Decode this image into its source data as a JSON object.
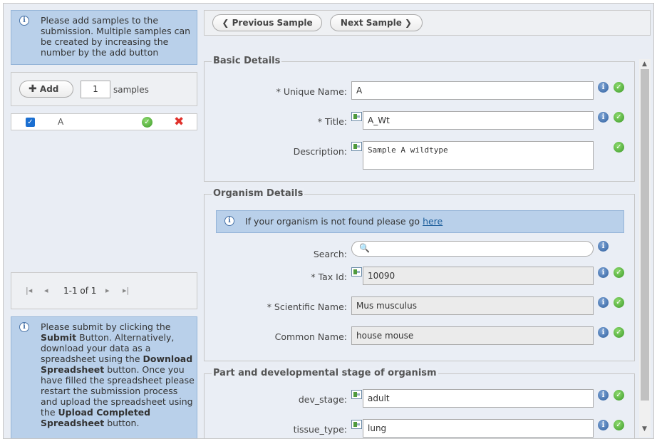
{
  "left": {
    "top_info": "Please add samples to the submission. Multiple samples can be created by increasing the number by the add button",
    "add_label": "Add",
    "count_value": "1",
    "samples_label": "samples",
    "list": [
      {
        "name": "A",
        "checked": true
      }
    ],
    "pager_text": "1-1 of 1",
    "bottom_info": [
      {
        "t": "Please submit by clicking the ",
        "b": false
      },
      {
        "t": "Submit",
        "b": true
      },
      {
        "t": " Button. Alternatively, download your data as a spreadsheet using the ",
        "b": false
      },
      {
        "t": "Download Spreadsheet",
        "b": true
      },
      {
        "t": " button. Once you have filled the spreadsheet please restart the submission process and upload the spreadsheet using the ",
        "b": false
      },
      {
        "t": "Upload Completed Spreadsheet",
        "b": true
      },
      {
        "t": " button.",
        "b": false
      }
    ]
  },
  "toolbar": {
    "prev_label": "Previous Sample",
    "next_label": "Next Sample"
  },
  "basic": {
    "legend": "Basic Details",
    "unique_label": "* Unique Name:",
    "unique_value": "A",
    "title_label": "* Title:",
    "title_value": "A_Wt",
    "desc_label": "Description:",
    "desc_value": "Sample A wildtype"
  },
  "organism": {
    "legend": "Organism Details",
    "notice_text": "If your organism is not found please go ",
    "notice_link": "here",
    "search_label": "Search:",
    "search_value": "",
    "taxid_label": "* Tax Id:",
    "taxid_value": "10090",
    "sci_label": "* Scientific Name:",
    "sci_value": "Mus musculus",
    "common_label": "Common Name:",
    "common_value": "house mouse"
  },
  "part": {
    "legend": "Part and developmental stage of organism",
    "dev_label": "dev_stage:",
    "dev_value": "adult",
    "tissue_label": "tissue_type:",
    "tissue_value": "lung"
  },
  "icons": {
    "info": "info-icon",
    "valid": "check-icon",
    "delete": "delete-icon",
    "edit": "edit-icon",
    "search": "magnifier-icon"
  },
  "colors": {
    "info_bg": "#b9d0ea",
    "valid_green": "#3d9a2a",
    "delete_red": "#e0312b"
  }
}
